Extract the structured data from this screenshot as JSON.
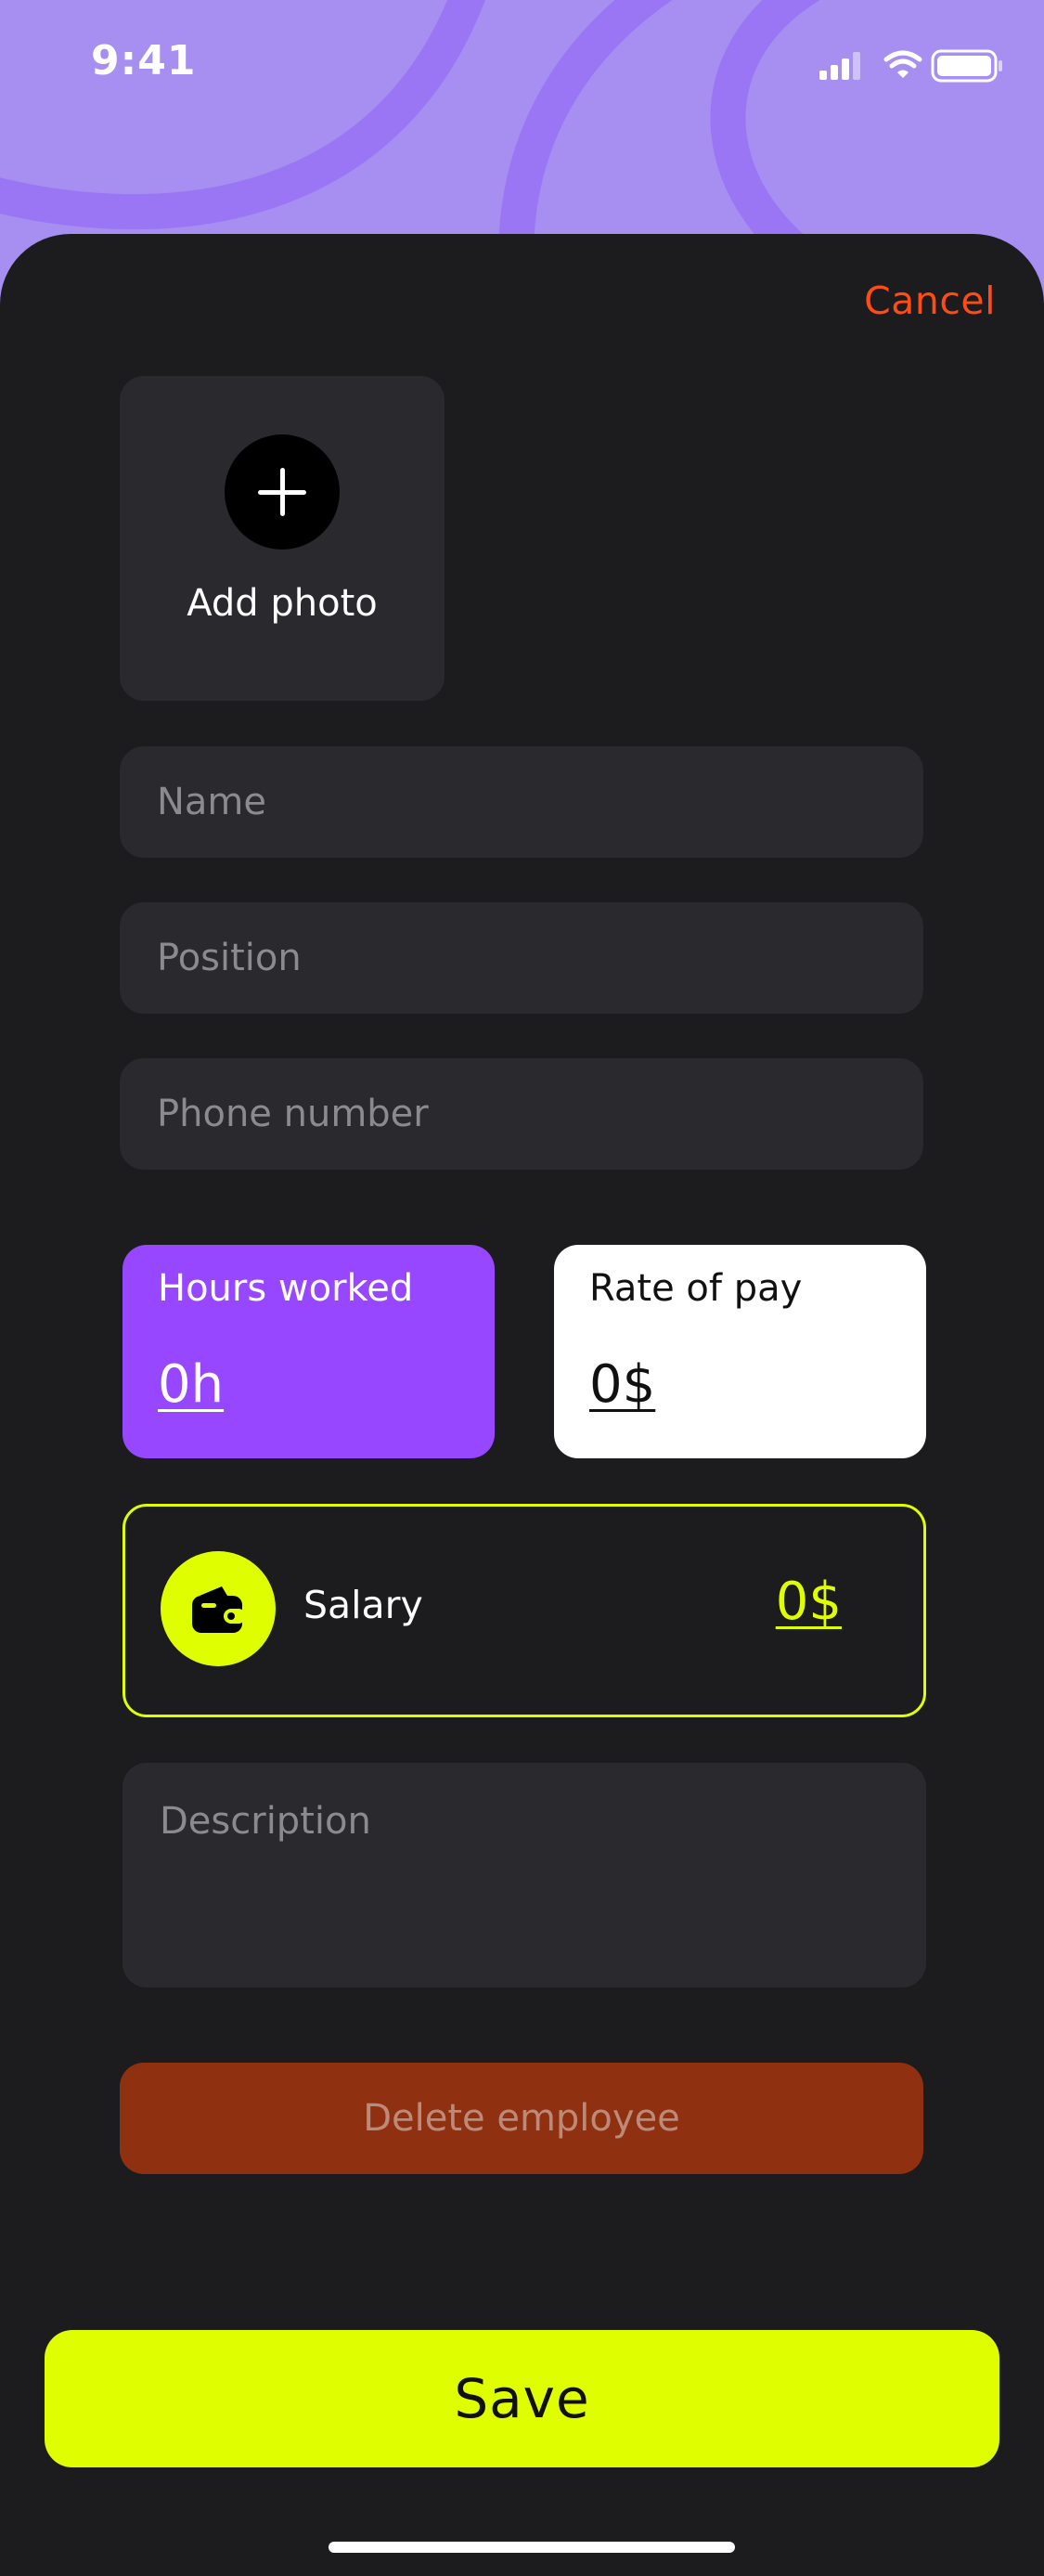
{
  "status_bar": {
    "time": "9:41",
    "icons": [
      "cellular-signal-icon",
      "wifi-icon",
      "battery-icon"
    ]
  },
  "header": {
    "cancel_label": "Cancel"
  },
  "photo": {
    "icon": "plus-icon",
    "label": "Add photo"
  },
  "form": {
    "name_placeholder": "Name",
    "position_placeholder": "Position",
    "phone_placeholder": "Phone number",
    "description_placeholder": "Description"
  },
  "stats": {
    "hours_label": "Hours worked",
    "hours_value": "0h",
    "rate_label": "Rate of pay",
    "rate_value": "0$"
  },
  "salary": {
    "icon": "wallet-icon",
    "label": "Salary",
    "value": "0$"
  },
  "actions": {
    "delete_label": "Delete employee",
    "save_label": "Save"
  },
  "colors": {
    "header_purple": "#a68ff0",
    "sheet_dark": "#1c1c1f",
    "field_bg": "#2a2a2e",
    "accent_lime": "#dfff00",
    "accent_purple": "#9747ff",
    "cancel_orange": "#ff4b14",
    "delete_brown": "#8f3111"
  }
}
